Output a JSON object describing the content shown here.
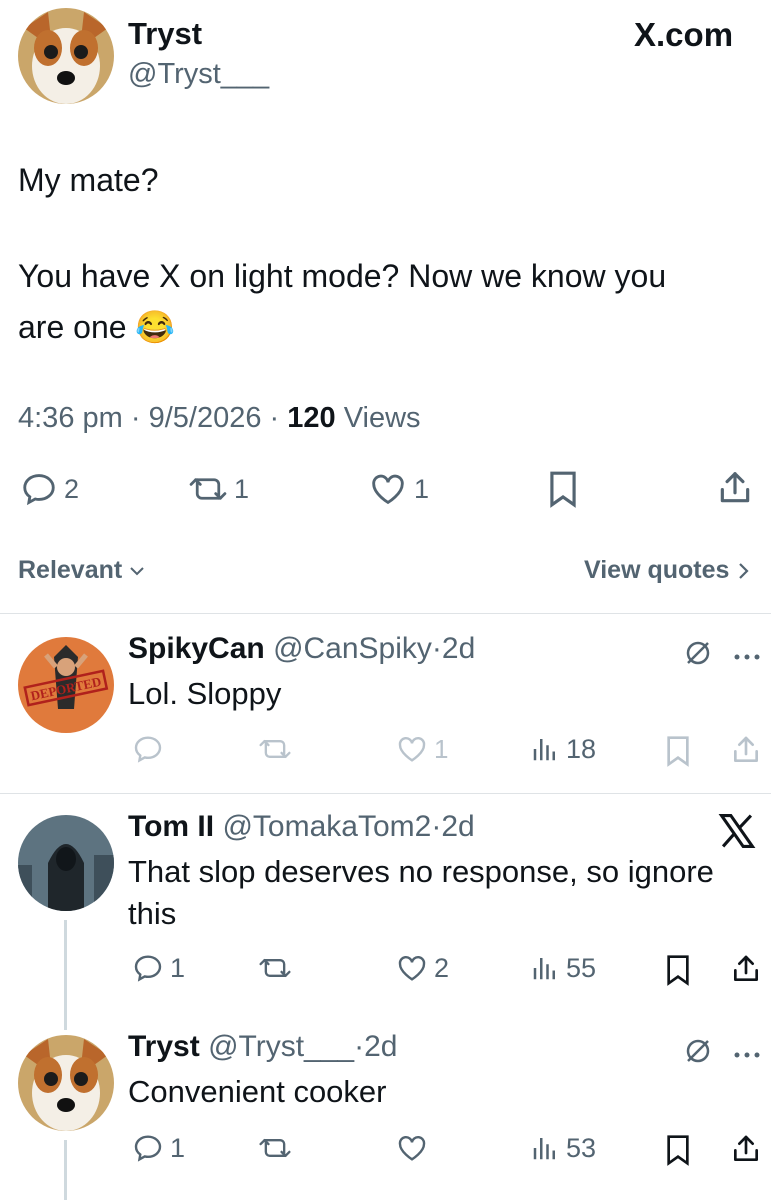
{
  "site_label": "X.com",
  "tweet": {
    "author_name": "Tryst",
    "author_handle": "@Tryst___",
    "text_line1": "My mate?",
    "text_line2": "You have X on light mode? Now we know you",
    "text_line3": "are one",
    "emoji": "😂",
    "time": "4:36 pm",
    "date": "9/5/2026",
    "views_count": "120",
    "views_label": "Views",
    "replies": "2",
    "reposts": "1",
    "likes": "1"
  },
  "sort": {
    "label": "Relevant",
    "view_quotes": "View quotes"
  },
  "replies": [
    {
      "name": "SpikyCan",
      "handle": "@CanSpiky",
      "age": "2d",
      "text": "Lol. Sloppy",
      "avatar_text": "DEPORTED",
      "replies": "",
      "reposts": "",
      "likes": "1",
      "views": "18"
    },
    {
      "name": "Tom II",
      "handle": "@TomakaTom2",
      "age": "2d",
      "text_line1": "That slop deserves no response, so ignore",
      "text_line2": "this",
      "replies": "1",
      "reposts": "",
      "likes": "2",
      "views": "55"
    },
    {
      "name": "Tryst",
      "handle": "@Tryst___",
      "age": "2d",
      "text": "Convenient cooker",
      "replies": "1",
      "reposts": "",
      "likes": "",
      "views": "53"
    }
  ],
  "colors": {
    "text": "#0f1419",
    "muted": "#536471",
    "faded": "#b9c3cc",
    "divider": "#dfe3e6"
  }
}
